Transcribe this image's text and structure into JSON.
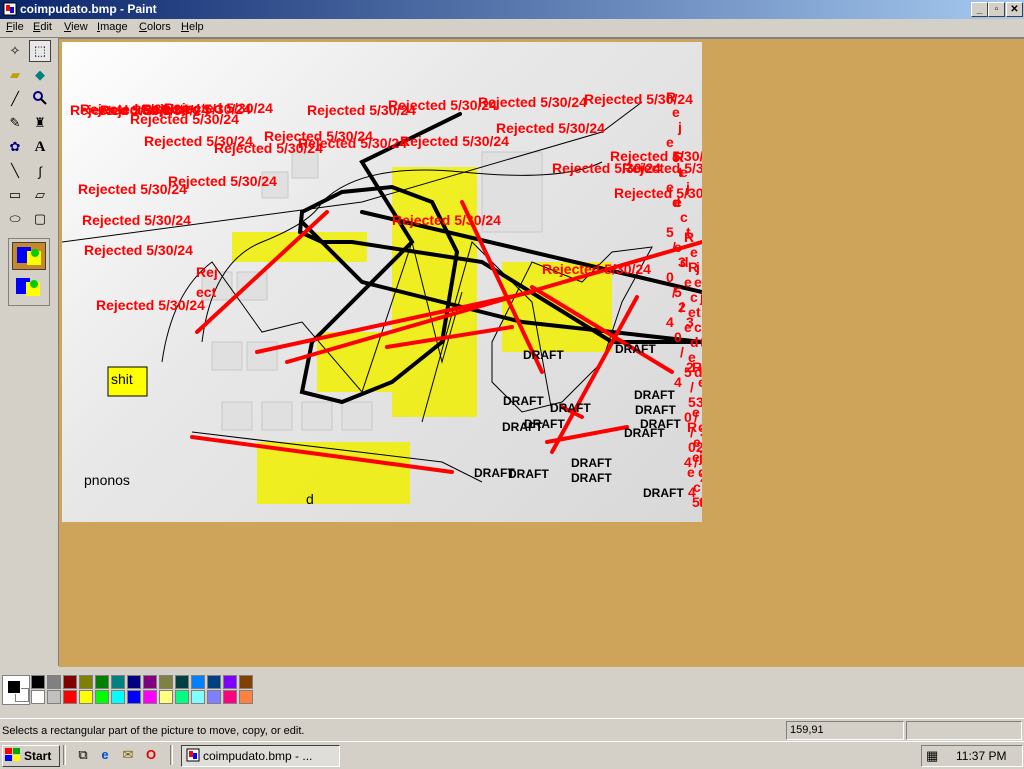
{
  "window": {
    "title": "coimpudato.bmp - Paint",
    "min_label": "_",
    "max_label": "▫",
    "close_label": "✕"
  },
  "menu": [
    "File",
    "Edit",
    "View",
    "Image",
    "Colors",
    "Help"
  ],
  "tools": [
    {
      "name": "free-form-select-icon",
      "glyph": "✧"
    },
    {
      "name": "select-icon",
      "glyph": "⬚"
    },
    {
      "name": "eraser-icon",
      "glyph": "▰"
    },
    {
      "name": "fill-icon",
      "glyph": "◆"
    },
    {
      "name": "pick-color-icon",
      "glyph": "╱"
    },
    {
      "name": "magnifier-icon",
      "glyph": "🔍"
    },
    {
      "name": "pencil-icon",
      "glyph": "✎"
    },
    {
      "name": "brush-icon",
      "glyph": "♜"
    },
    {
      "name": "airbrush-icon",
      "glyph": "✿"
    },
    {
      "name": "text-icon",
      "glyph": "A"
    },
    {
      "name": "line-icon",
      "glyph": "╲"
    },
    {
      "name": "curve-icon",
      "glyph": "∫"
    },
    {
      "name": "rectangle-icon",
      "glyph": "▭"
    },
    {
      "name": "polygon-icon",
      "glyph": "▱"
    },
    {
      "name": "ellipse-icon",
      "glyph": "⬭"
    },
    {
      "name": "rounded-rectangle-icon",
      "glyph": "▢"
    }
  ],
  "palette": {
    "foreground": "#000000",
    "background": "#ffffff",
    "colors_top": [
      "#000000",
      "#808080",
      "#800000",
      "#808000",
      "#008000",
      "#008080",
      "#000080",
      "#800080",
      "#808040",
      "#004040",
      "#0080ff",
      "#004080",
      "#8000ff",
      "#804000"
    ],
    "colors_bottom": [
      "#ffffff",
      "#c0c0c0",
      "#ff0000",
      "#ffff00",
      "#00ff00",
      "#00ffff",
      "#0000ff",
      "#ff00ff",
      "#ffff80",
      "#00ff80",
      "#80ffff",
      "#8080ff",
      "#ff0080",
      "#ff8040"
    ]
  },
  "canvas": {
    "stamp_text": "Rejected 5/30/24",
    "draft_text": "DRAFT",
    "ect_text": "Rej\nect",
    "yellow_label": "shit",
    "corner_label": "pnonos",
    "letter_d": "d",
    "ink_red": "#ff0000",
    "ink_black": "#000000",
    "highlight": "#f0f000"
  },
  "status": {
    "message": "Selects a rectangular part of the picture to move, copy, or edit.",
    "coords": "159,91"
  },
  "taskbar": {
    "start_label": "Start",
    "task_label": "coimpudato.bmp - ...",
    "clock": "11:37 PM"
  }
}
